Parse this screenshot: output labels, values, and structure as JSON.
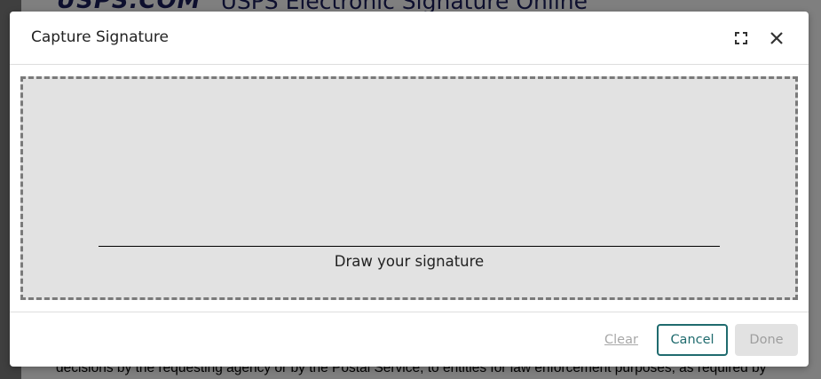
{
  "background": {
    "logo": "USPS.COM",
    "header_title": "USPS Electronic Signature Online",
    "body_text": "decisions by the requesting agency or by the Postal Service; to entities for law enforcement purposes, as required by"
  },
  "modal": {
    "title": "Capture Signature",
    "fullscreen_icon": "fullscreen-icon",
    "close_icon": "close-icon",
    "signature_caption": "Draw your signature",
    "buttons": {
      "clear": "Clear",
      "cancel": "Cancel",
      "done": "Done"
    },
    "button_states": {
      "clear_enabled": false,
      "cancel_enabled": true,
      "done_enabled": false
    }
  },
  "colors": {
    "accent": "#1f6b6e",
    "pad_background": "#e2e2e2",
    "brand_navy": "#1a1f5c"
  }
}
